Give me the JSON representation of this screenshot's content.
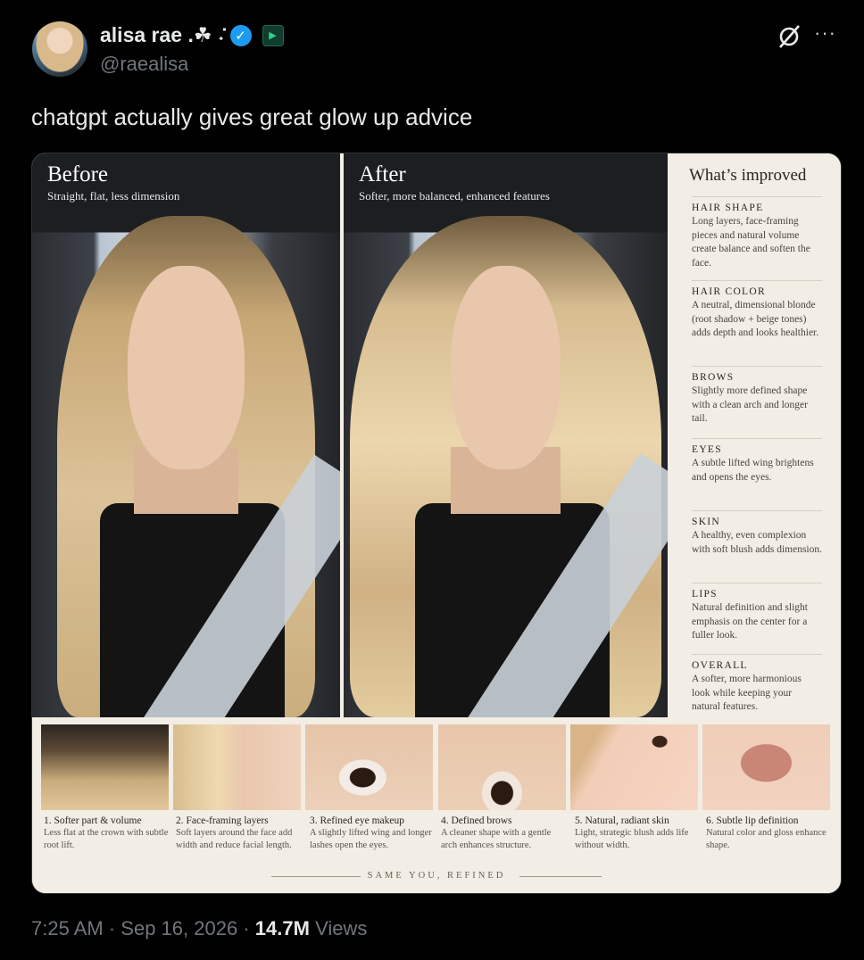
{
  "tweet": {
    "display_name": "alisa rae .☘︎ ݁˖",
    "handle": "@raealisa",
    "text": "chatgpt actually gives great glow up advice",
    "time": "7:25 AM",
    "date": "Sep 16, 2026",
    "views_count": "14.7M",
    "views_label": "Views",
    "separator": "·"
  },
  "image": {
    "before": {
      "title": "Before",
      "subtitle": "Straight, flat, less dimension"
    },
    "after": {
      "title": "After",
      "subtitle": "Softer, more balanced, enhanced features"
    },
    "side": {
      "heading": "What’s improved",
      "sections": [
        {
          "label": "HAIR SHAPE",
          "text": "Long layers, face-framing pieces and natural volume create balance and soften the face."
        },
        {
          "label": "HAIR COLOR",
          "text": "A neutral, dimensional blonde (root shadow + beige tones) adds depth and looks healthier."
        },
        {
          "label": "BROWS",
          "text": "Slightly more defined shape with a clean arch and longer tail."
        },
        {
          "label": "EYES",
          "text": "A subtle lifted wing brightens and opens the eyes."
        },
        {
          "label": "SKIN",
          "text": "A healthy, even complexion with soft blush adds dimension."
        },
        {
          "label": "LIPS",
          "text": "Natural definition and slight emphasis on the center for a fuller look."
        },
        {
          "label": "OVERALL",
          "text": "A softer, more harmonious look while keeping your natural features."
        }
      ]
    },
    "details": [
      {
        "title": "1. Softer part & volume",
        "text": "Less flat at the crown with subtle root lift."
      },
      {
        "title": "2. Face-framing layers",
        "text": "Soft layers around the face add width and reduce facial length."
      },
      {
        "title": "3. Refined eye makeup",
        "text": "A slightly lifted wing and longer lashes open the eyes."
      },
      {
        "title": "4. Defined brows",
        "text": "A cleaner shape with a gentle arch enhances structure."
      },
      {
        "title": "5. Natural, radiant skin",
        "text": "Light, strategic blush adds life without width."
      },
      {
        "title": "6. Subtle lip definition",
        "text": "Natural color and gloss enhance shape."
      }
    ],
    "footer": "SAME YOU, REFINED"
  },
  "colors": {
    "background": "#000000",
    "text": "#e7e9ea",
    "muted": "#71767b",
    "verified": "#1d9bf0",
    "panel": "#f2ede5"
  }
}
